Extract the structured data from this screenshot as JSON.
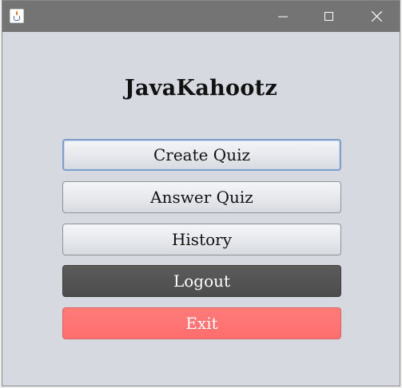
{
  "window": {
    "title": "",
    "icon": "java-icon",
    "controls": {
      "minimize": "minimize-icon",
      "maximize": "maximize-icon",
      "close": "close-icon"
    }
  },
  "main": {
    "title": "JavaKahootz",
    "buttons": {
      "create_quiz": "Create Quiz",
      "answer_quiz": "Answer Quiz",
      "history": "History",
      "logout": "Logout",
      "exit": "Exit"
    }
  },
  "colors": {
    "titlebar": "#747474",
    "background": "#d6d9df",
    "logout_button": "#4c4c4c",
    "exit_button": "#fd6e6e",
    "focus_border": "#7f9fc8"
  }
}
